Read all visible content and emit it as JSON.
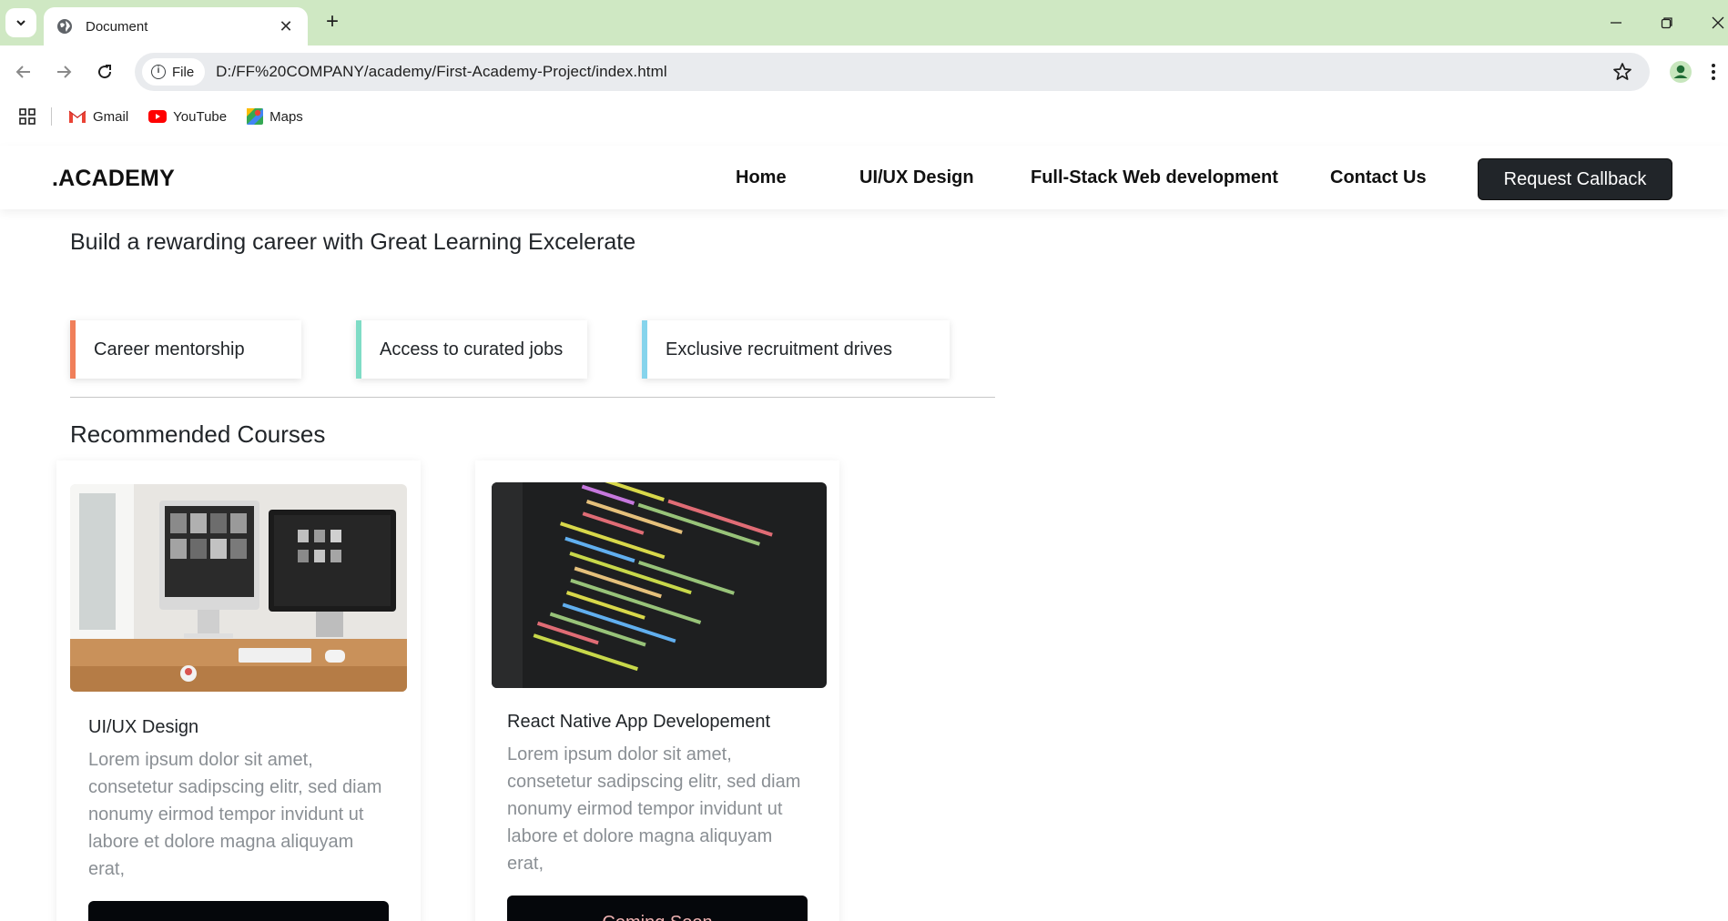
{
  "browser": {
    "tab_title": "Document",
    "chip_label": "File",
    "url": "D:/FF%20COMPANY/academy/First-Academy-Project/index.html",
    "bookmarks": [
      {
        "label": "Gmail",
        "icon": "gmail-icon"
      },
      {
        "label": "YouTube",
        "icon": "youtube-icon"
      },
      {
        "label": "Maps",
        "icon": "maps-icon"
      }
    ]
  },
  "site": {
    "logo": ".ACADEMY",
    "nav": {
      "home": "Home",
      "uiux": "UI/UX Design",
      "fullstack": "Full-Stack Web development",
      "contact": "Contact Us",
      "callback": "Request Callback"
    },
    "hero_title": "Build a rewarding career with Great Learning Excelerate",
    "features": [
      {
        "label": "Career mentorship",
        "color": "#f07f5a"
      },
      {
        "label": "Access to curated jobs",
        "color": "#7fdcc6"
      },
      {
        "label": "Exclusive recruitment drives",
        "color": "#86d4ec"
      }
    ],
    "section_title": "Recommended Courses",
    "courses": [
      {
        "title": "UI/UX Design",
        "text": "Lorem ipsum dolor sit amet, consetetur sadipscing elitr, sed diam nonumy eirmod tempor invidunt ut labore et dolore magna aliquyam erat,",
        "button": ""
      },
      {
        "title": "React Native App Developement",
        "text": "Lorem ipsum dolor sit amet, consetetur sadipscing elitr, sed diam nonumy eirmod tempor invidunt ut labore et dolore magna aliquyam erat,",
        "button": "Coming Soon"
      }
    ]
  }
}
